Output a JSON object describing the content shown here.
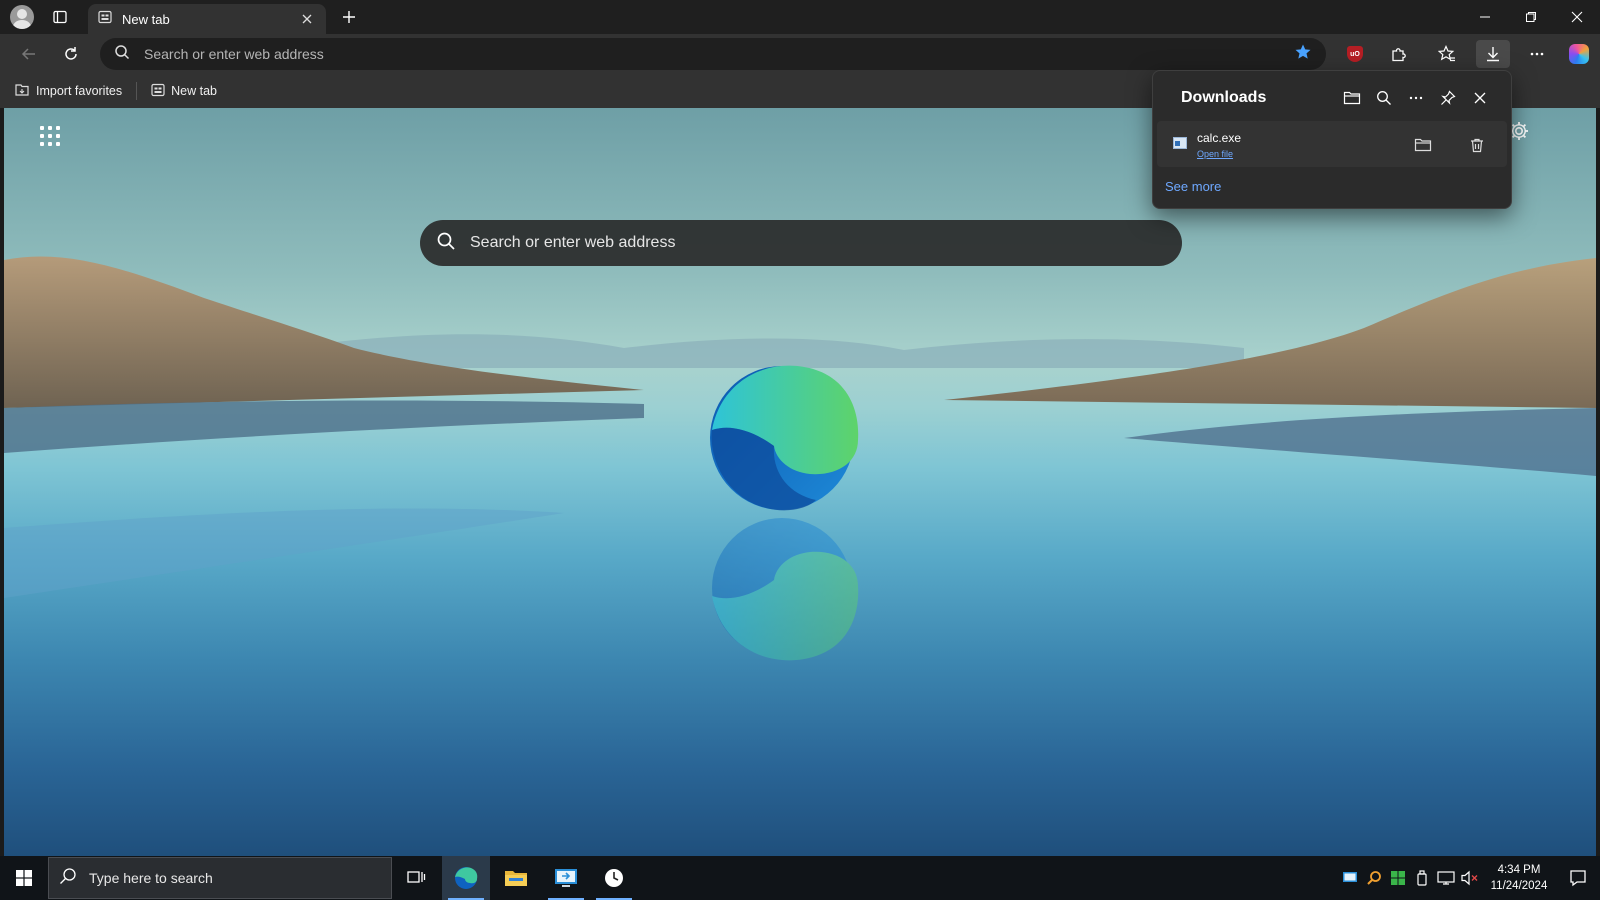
{
  "tab": {
    "title": "New tab"
  },
  "address_bar": {
    "placeholder": "Search or enter web address"
  },
  "favorites_bar": {
    "items": [
      {
        "label": "Import favorites"
      },
      {
        "label": "New tab"
      }
    ]
  },
  "new_tab_page": {
    "search_placeholder": "Search or enter web address"
  },
  "downloads": {
    "title": "Downloads",
    "items": [
      {
        "name": "calc.exe",
        "action": "Open file"
      }
    ],
    "see_more": "See more"
  },
  "extensions": {
    "ublock_badge": "uO"
  },
  "taskbar": {
    "search_placeholder": "Type here to search",
    "time": "4:34 PM",
    "date": "11/24/2024"
  },
  "colors": {
    "accent_blue": "#6ea8ff",
    "favorite_star": "#4aa3ff",
    "ublock_red": "#b51e24",
    "tab_active_bg": "#323232",
    "chrome_bg": "#1f1f1f"
  }
}
